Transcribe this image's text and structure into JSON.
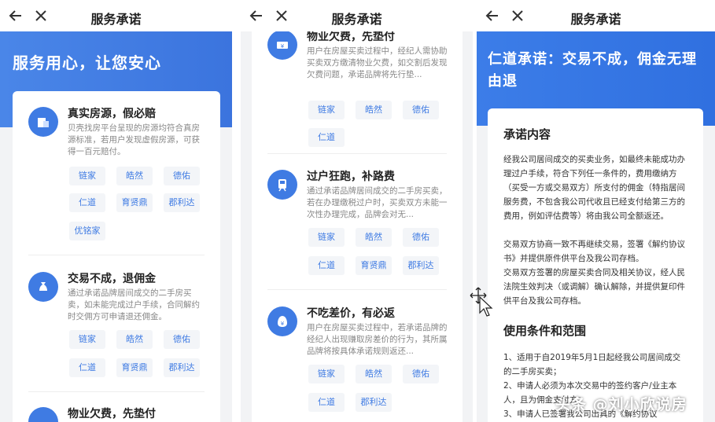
{
  "nav": {
    "title": "服务承诺"
  },
  "panel1": {
    "hero": "服务用心，让您安心",
    "items": [
      {
        "title": "真实房源，假必赔",
        "desc": "贝壳找房平台呈现的房源均符合真房源标准，若用户发现虚假房源，可获得一百元赔付。",
        "tags": [
          "链家",
          "皓然",
          "德佑",
          "仁道",
          "育贤鼎",
          "郡利达",
          "优铭家"
        ]
      },
      {
        "title": "交易不成，退佣金",
        "desc": "通过承诺品牌居间成交的二手房买卖，如未能完成过户手续，合同解约时交佣方可申请退还佣金。",
        "tags": [
          "链家",
          "皓然",
          "德佑",
          "仁道",
          "育贤鼎",
          "郡利达"
        ]
      },
      {
        "title": "物业欠费，先垫付"
      }
    ]
  },
  "panel2": {
    "items": [
      {
        "title": "物业欠费，先垫付",
        "desc": "用户在房屋买卖过程中，经纪人需协助买卖双方缴清物业欠费，如交割后发现欠费问题，承诺品牌将先行垫...",
        "tags": [
          "链家",
          "皓然",
          "德佑",
          "仁道"
        ]
      },
      {
        "title": "过户狂跑，补路费",
        "desc": "通过承诺品牌居间成交的二手房买卖，若在办理缴税过户时，买卖双方未能一次性办理完成，品牌会对无...",
        "tags": [
          "链家",
          "皓然",
          "德佑",
          "仁道",
          "育贤鼎",
          "郡利达"
        ]
      },
      {
        "title": "不吃差价，有必返",
        "desc": "用户在房屋买卖过程中，若承诺品牌的经纪人出现赚取房差价的行为，其所属品牌将按具体承诺规则返还...",
        "tags": [
          "链家",
          "皓然",
          "德佑",
          "仁道",
          "郡利达"
        ]
      }
    ]
  },
  "panel3": {
    "hero": "仁道承诺：交易不成，佣金无理由退",
    "section1_title": "承诺内容",
    "section1_paras": [
      "经我公司居间成交的买卖业务，如最终未能成功办理过户手续，符合下列任一条件的，费用缴纳方（买受一方或交易双方）所支付的佣金（特指居间服务费，不包含我公司代收且已经支付给第三方的费用，例如评估费等）将由我公司全额返还。",
      "交易双方协商一致不再继续交易，签署《解约协议书》并提供原件供平台及我公司存档。",
      "交易双方签署的房屋买卖合同及相关协议，经人民法院生效判决（或调解）确认解除，并提供复印件供平台及我公司存档。"
    ],
    "section2_title": "使用条件和范围",
    "section2_paras": [
      "1、适用于自2019年5月1日起经我公司居间成交的二手房买卖；",
      "2、申请人必须为本次交易中的签约客户/业主本人，且为佣金支付方；",
      "3、申请人已签署我公司出具的《解约协议"
    ]
  },
  "watermark": "头条 @刘小欣说房",
  "colors": {
    "accent": "#3f7be3",
    "tag_bg": "#f3f5f8"
  }
}
